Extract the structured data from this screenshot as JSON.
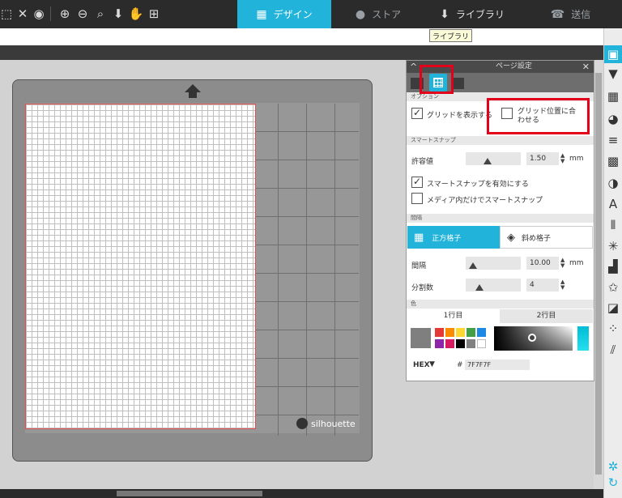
{
  "toolbar": {
    "tools": [
      "marquee-icon",
      "delete-x-icon",
      "eye-icon",
      "zoom-in-icon",
      "zoom-out-icon",
      "zoom-fit-icon",
      "move-down-icon",
      "hand-pan-icon",
      "add-frame-icon"
    ]
  },
  "tabs": [
    {
      "label": "デザイン",
      "icon": "grid-icon",
      "active": true
    },
    {
      "label": "ストア",
      "icon": "store-s-icon",
      "active": false
    },
    {
      "label": "ライブラリ",
      "icon": "library-icon",
      "active": false
    },
    {
      "label": "送信",
      "icon": "send-cutter-icon",
      "active": false
    }
  ],
  "tooltip": "ライブラリ",
  "mat": {
    "brand": "silhouette"
  },
  "panel": {
    "title": "ページ設定",
    "sections": {
      "options": "オプション",
      "smart_snap": "スマートスナップ",
      "spacing": "間隔",
      "color": "色"
    },
    "show_grid": {
      "label": "グリッドを表示する",
      "checked": true
    },
    "snap_to_grid": {
      "label": "グリッド位置に合わせる",
      "checked": false
    },
    "tolerance": {
      "label": "許容値",
      "value": "1.50",
      "unit": "mm"
    },
    "enable_smart_snap": {
      "label": "スマートスナップを有効にする",
      "checked": true
    },
    "media_only_snap": {
      "label": "メディア内だけでスマートスナップ",
      "checked": false
    },
    "grid_types": {
      "square": "正方格子",
      "diagonal": "斜め格子"
    },
    "spacing_value": {
      "label": "間隔",
      "value": "10.00",
      "unit": "mm"
    },
    "divisions": {
      "label": "分割数",
      "value": "4"
    },
    "row_tabs": [
      "1行目",
      "2行目"
    ],
    "hex_label": "HEX",
    "hex_prefix": "#",
    "hex_value": "7F7F7F",
    "colors": {
      "selected": "#7f7f7f",
      "swatches_row1": [
        "#e53935",
        "#fb8c00",
        "#fdd835",
        "#43a047",
        "#1e88e5"
      ],
      "swatches_row2": [
        "#8e24aa",
        "#d81b60",
        "#000000",
        "#808080",
        "#ffffff"
      ]
    }
  },
  "right_panel_icons": [
    "page-settings-icon",
    "send-panel-icon",
    "pixel-scan-icon",
    "fill-color-icon",
    "line-style-icon",
    "replicate-icon",
    "half-contrast-icon",
    "text-icon",
    "align-icon",
    "transform-icon",
    "offset-icon",
    "star-shape-icon",
    "trace-icon",
    "sketch-icon",
    "hatch-icon",
    "settings-gear-icon",
    "refresh-icon"
  ]
}
